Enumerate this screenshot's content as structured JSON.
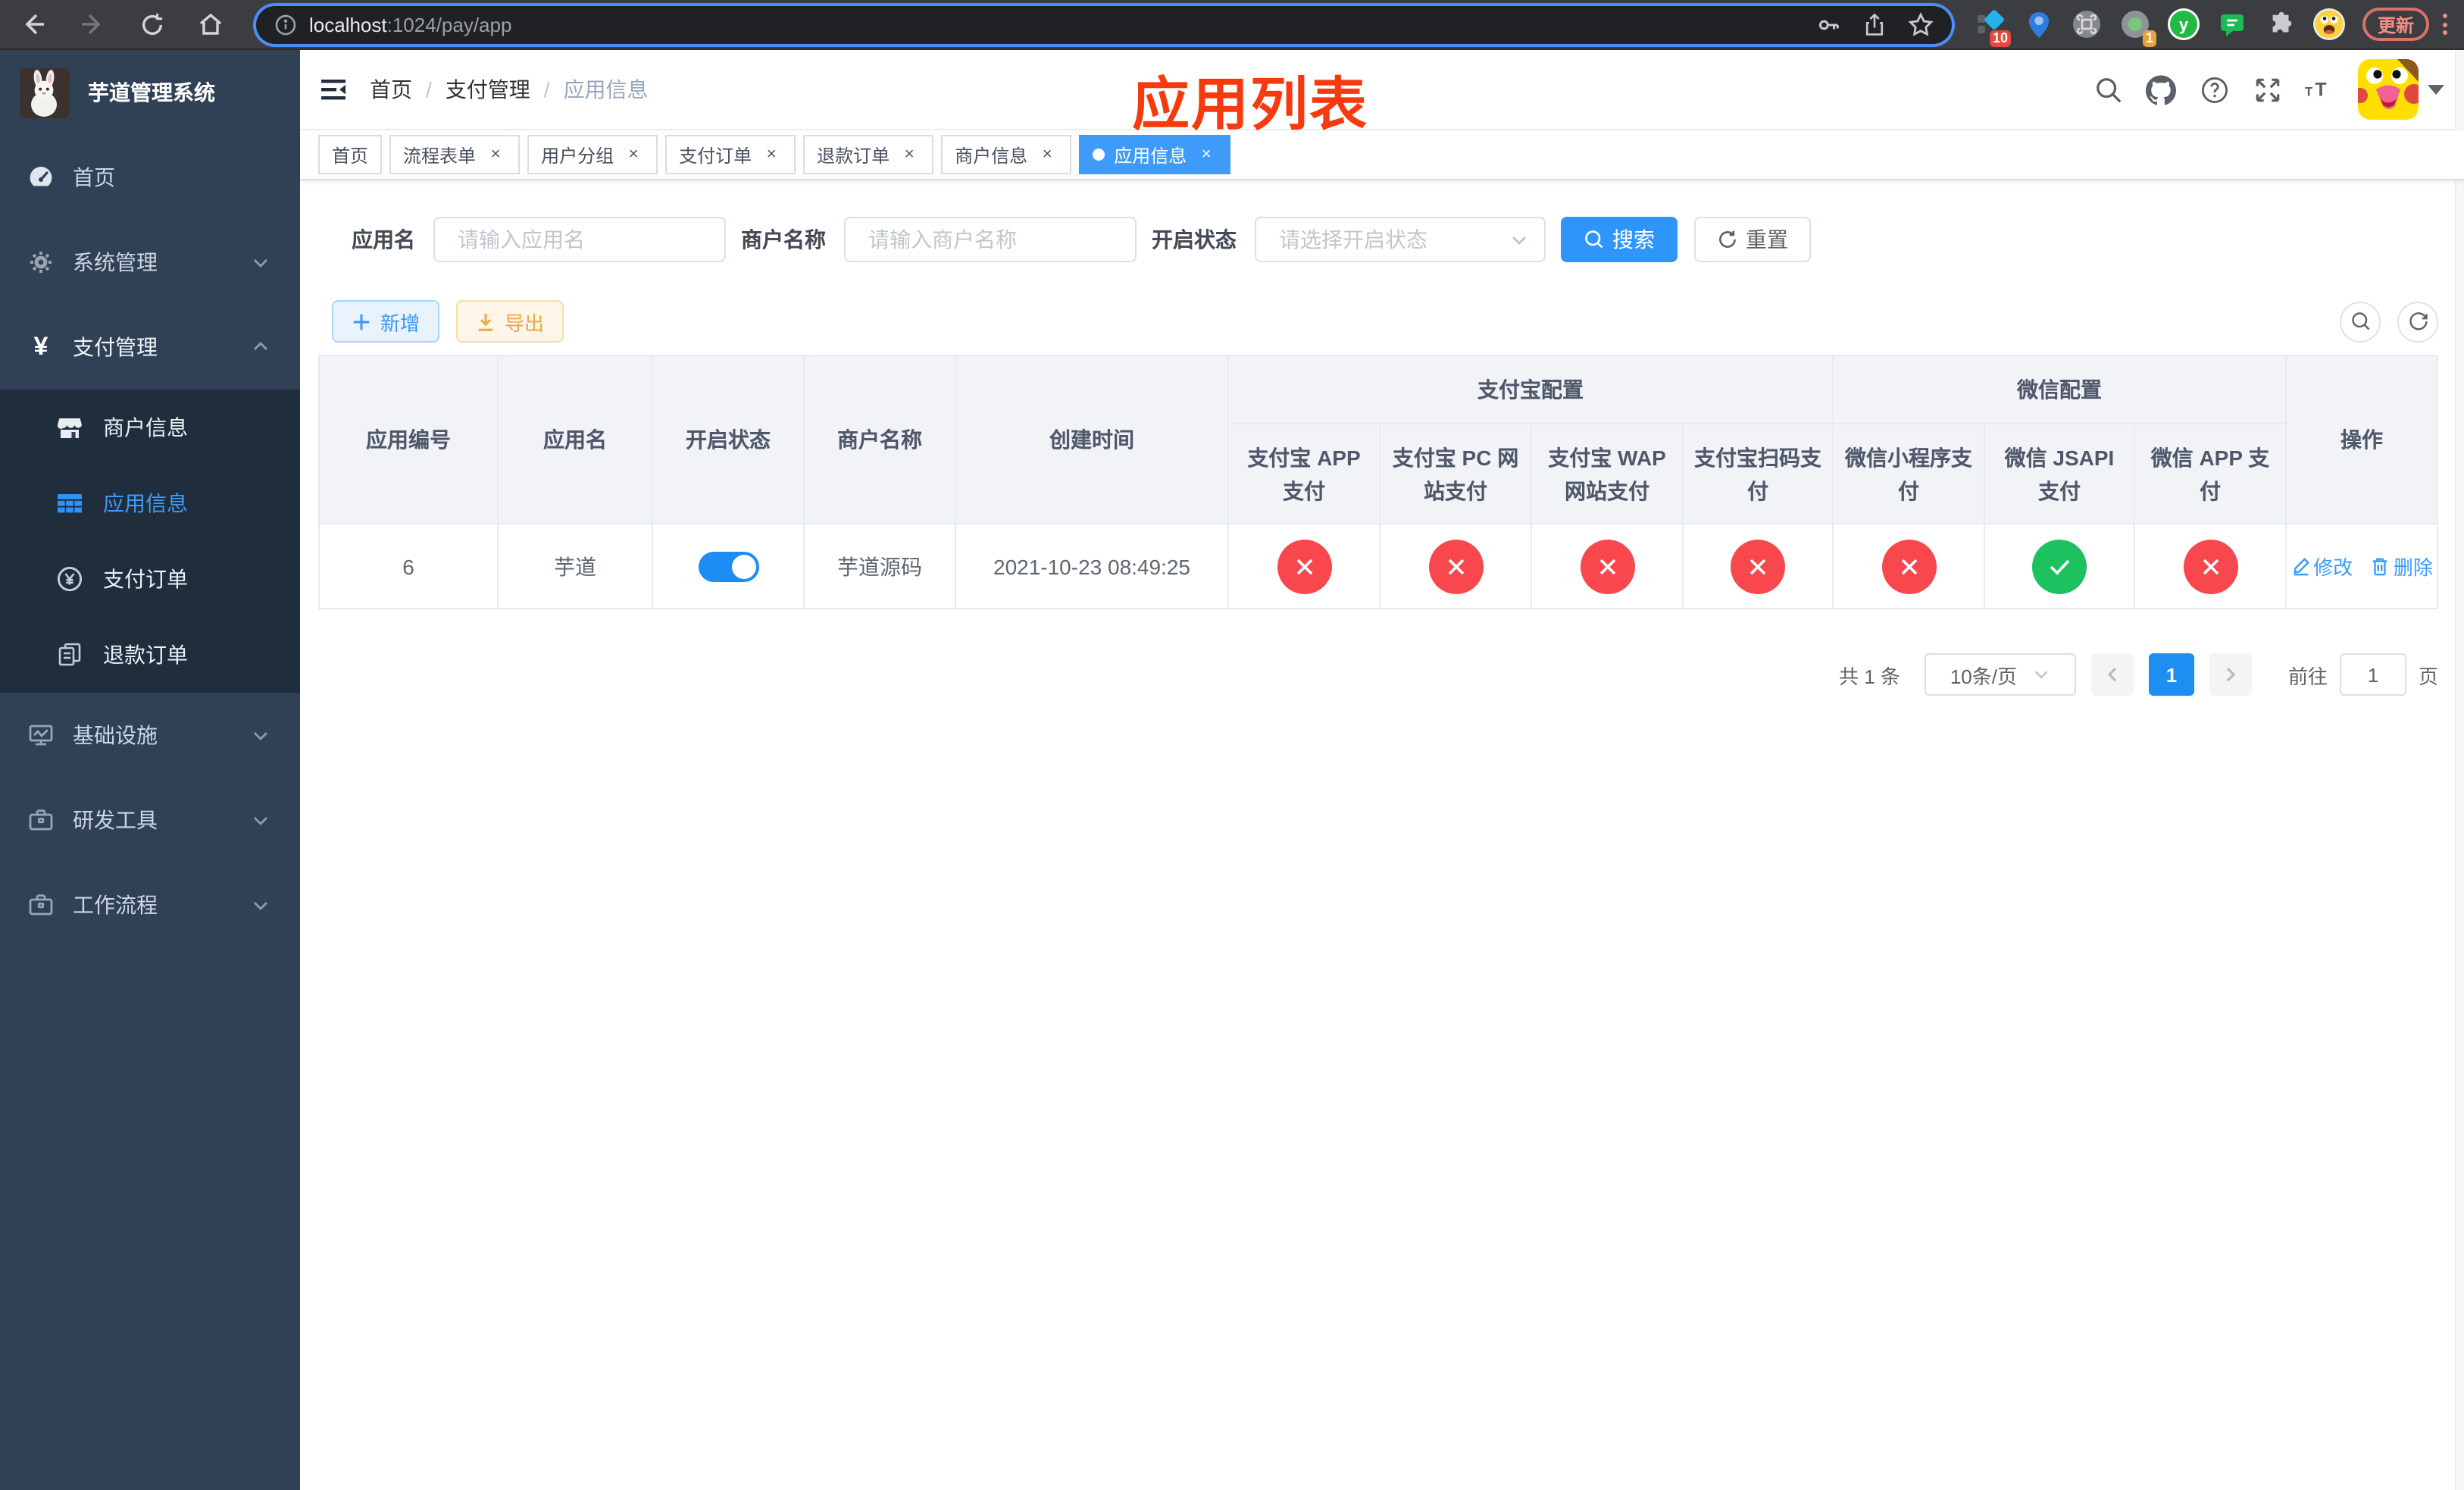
{
  "browser": {
    "url_host": "localhost",
    "url_rest": ":1024/pay/app",
    "update_label": "更新",
    "ext_badge_a": "10",
    "ext_badge_b": "1"
  },
  "sidebar": {
    "title": "芋道管理系统",
    "items": [
      {
        "label": "首页"
      },
      {
        "label": "系统管理"
      },
      {
        "label": "支付管理"
      },
      {
        "label": "商户信息"
      },
      {
        "label": "应用信息"
      },
      {
        "label": "支付订单"
      },
      {
        "label": "退款订单"
      },
      {
        "label": "基础设施"
      },
      {
        "label": "研发工具"
      },
      {
        "label": "工作流程"
      }
    ]
  },
  "header": {
    "breadcrumb": [
      "首页",
      "支付管理",
      "应用信息"
    ],
    "annotation": "应用列表"
  },
  "tags": [
    {
      "label": "首页"
    },
    {
      "label": "流程表单"
    },
    {
      "label": "用户分组"
    },
    {
      "label": "支付订单"
    },
    {
      "label": "退款订单"
    },
    {
      "label": "商户信息"
    },
    {
      "label": "应用信息"
    }
  ],
  "filter": {
    "app_name_label": "应用名",
    "app_name_placeholder": "请输入应用名",
    "merchant_label": "商户名称",
    "merchant_placeholder": "请输入商户名称",
    "status_label": "开启状态",
    "status_placeholder": "请选择开启状态",
    "search_label": "搜索",
    "reset_label": "重置"
  },
  "toolbar": {
    "add_label": "新增",
    "export_label": "导出"
  },
  "table": {
    "columns": {
      "app_id": "应用编号",
      "app_name": "应用名",
      "status": "开启状态",
      "merchant": "商户名称",
      "created": "创建时间",
      "alipay_group": "支付宝配置",
      "wechat_group": "微信配置",
      "actions": "操作",
      "sub": [
        {
          "l1": "支付宝 APP",
          "l2": "支付"
        },
        {
          "l1": "支付宝 PC 网",
          "l2": "站支付"
        },
        {
          "l1": "支付宝 WAP",
          "l2": "网站支付"
        },
        {
          "l1": "支付宝扫码支",
          "l2": "付"
        },
        {
          "l1": "微信小程序支",
          "l2": "付"
        },
        {
          "l1": "微信 JSAPI",
          "l2": "支付"
        },
        {
          "l1": "微信 APP 支",
          "l2": "付"
        }
      ]
    },
    "row": {
      "app_id": "6",
      "app_name": "芋道",
      "enabled": "on",
      "merchant": "芋道源码",
      "created": "2021-10-23 08:49:25",
      "configs": [
        "no",
        "no",
        "no",
        "no",
        "no",
        "yes",
        "no"
      ],
      "edit_label": "修改",
      "delete_label": "删除"
    }
  },
  "pagination": {
    "total": "共 1 条",
    "page_size": "10条/页",
    "current": "1",
    "goto_label": "前往",
    "page_unit": "页"
  }
}
